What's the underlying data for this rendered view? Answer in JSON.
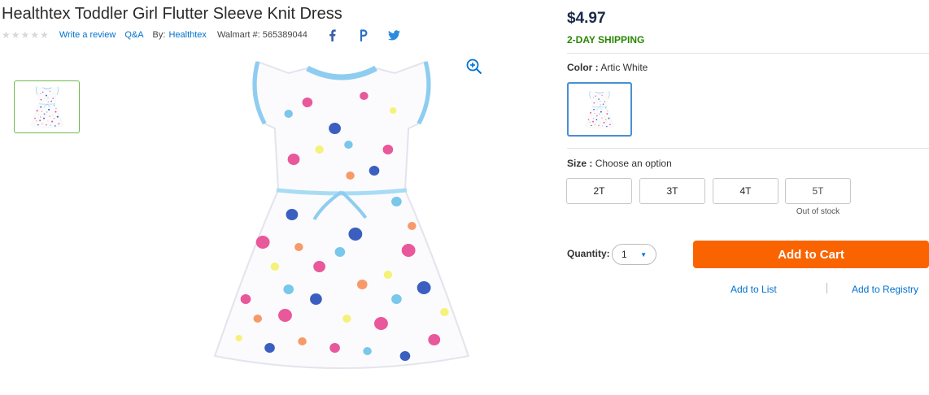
{
  "product": {
    "title": "Healthtex Toddler Girl Flutter Sleeve Knit Dress",
    "rating_stars": 5,
    "write_review": "Write a review",
    "qa": "Q&A",
    "by_label": "By:",
    "brand": "Healthtex",
    "walmart_number": "Walmart #: 565389044"
  },
  "social": {
    "facebook_icon": "facebook-icon",
    "pinterest_icon": "pinterest-icon",
    "twitter_icon": "twitter-icon"
  },
  "gallery": {
    "zoom_icon": "zoom-in-icon",
    "dress_image": "floral-print-dress",
    "thumbnails": [
      "floral-print-dress"
    ]
  },
  "purchase": {
    "price": "$4.97",
    "shipping": "2-DAY SHIPPING",
    "color_label": "Color :",
    "color_value": "Artic White",
    "size_label": "Size :",
    "size_value": "Choose an option",
    "sizes": [
      "2T",
      "3T",
      "4T",
      "5T"
    ],
    "out_of_stock": "Out of stock",
    "quantity_label": "Quantity:",
    "quantity_value": "1",
    "add_to_cart": "Add to Cart",
    "add_to_list": "Add to List",
    "add_to_registry": "Add to Registry"
  },
  "colors": {
    "accent_blue": "#0071ce",
    "cart_orange": "#fa6400",
    "shipping_green": "#2a8703",
    "thumb_border_green": "#6fba4a",
    "swatch_border_blue": "#4a8fd0"
  }
}
